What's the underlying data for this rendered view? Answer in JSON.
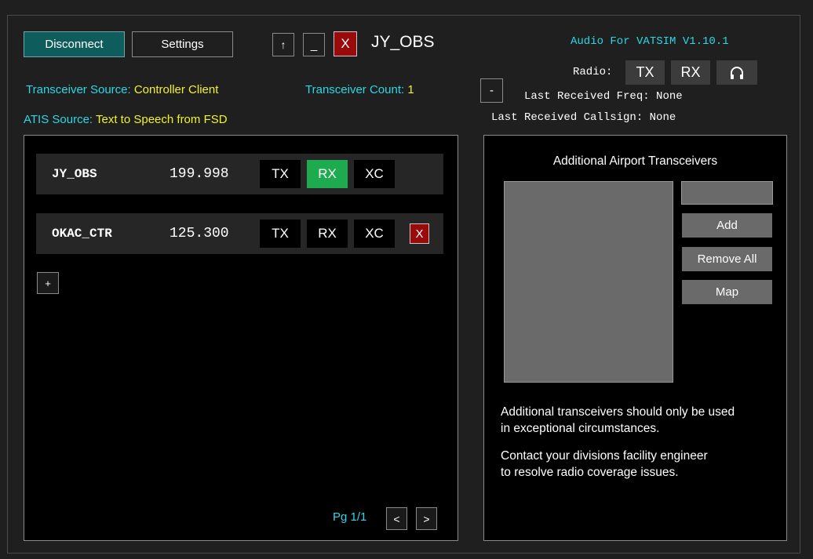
{
  "toolbar": {
    "disconnect_label": "Disconnect",
    "settings_label": "Settings",
    "up_label": "↑",
    "minimize_label": "_",
    "close_label": "X",
    "callsign": "JY_OBS"
  },
  "version": "Audio For VATSIM V1.10.1",
  "radio": {
    "label": "Radio:",
    "tx_label": "TX",
    "rx_label": "RX",
    "headset_icon": "headphones-icon"
  },
  "collapse_label": "-",
  "last_received": {
    "freq_label": "Last Received Freq:",
    "freq_value": "None",
    "callsign_label": "Last Received Callsign:",
    "callsign_value": "None"
  },
  "transceiver": {
    "source_label": "Transceiver Source:",
    "source_value": "Controller Client",
    "count_label": "Transceiver Count:",
    "count_value": "1"
  },
  "atis": {
    "source_label": "ATIS Source:",
    "source_value": "Text to Speech from FSD"
  },
  "stations": [
    {
      "callsign": "JY_OBS",
      "freq": "199.998",
      "tx": "TX",
      "rx": "RX",
      "xc": "XC",
      "rx_active": true
    },
    {
      "callsign": "OKAC_CTR",
      "freq": "125.300",
      "tx": "TX",
      "rx": "RX",
      "xc": "XC",
      "rx_active": false,
      "remove": "X"
    }
  ],
  "add_station_label": "+",
  "pager": {
    "label": "Pg 1/1",
    "prev": "<",
    "next": ">"
  },
  "airport": {
    "heading": "Additional Airport Transceivers",
    "input_value": "",
    "add_label": "Add",
    "remove_all_label": "Remove All",
    "map_label": "Map",
    "note1_line1": "Additional transceivers should only be used",
    "note1_line2": "in exceptional circumstances.",
    "note2_line1": "Contact your divisions facility engineer",
    "note2_line2": "to resolve radio coverage issues."
  },
  "colors": {
    "accent_cyan": "#2ad8e6",
    "accent_yellow": "#f2f22a",
    "rx_active": "#1eaa4e",
    "close_red": "#9b0a0a",
    "teal_button": "#0e5c5c"
  }
}
